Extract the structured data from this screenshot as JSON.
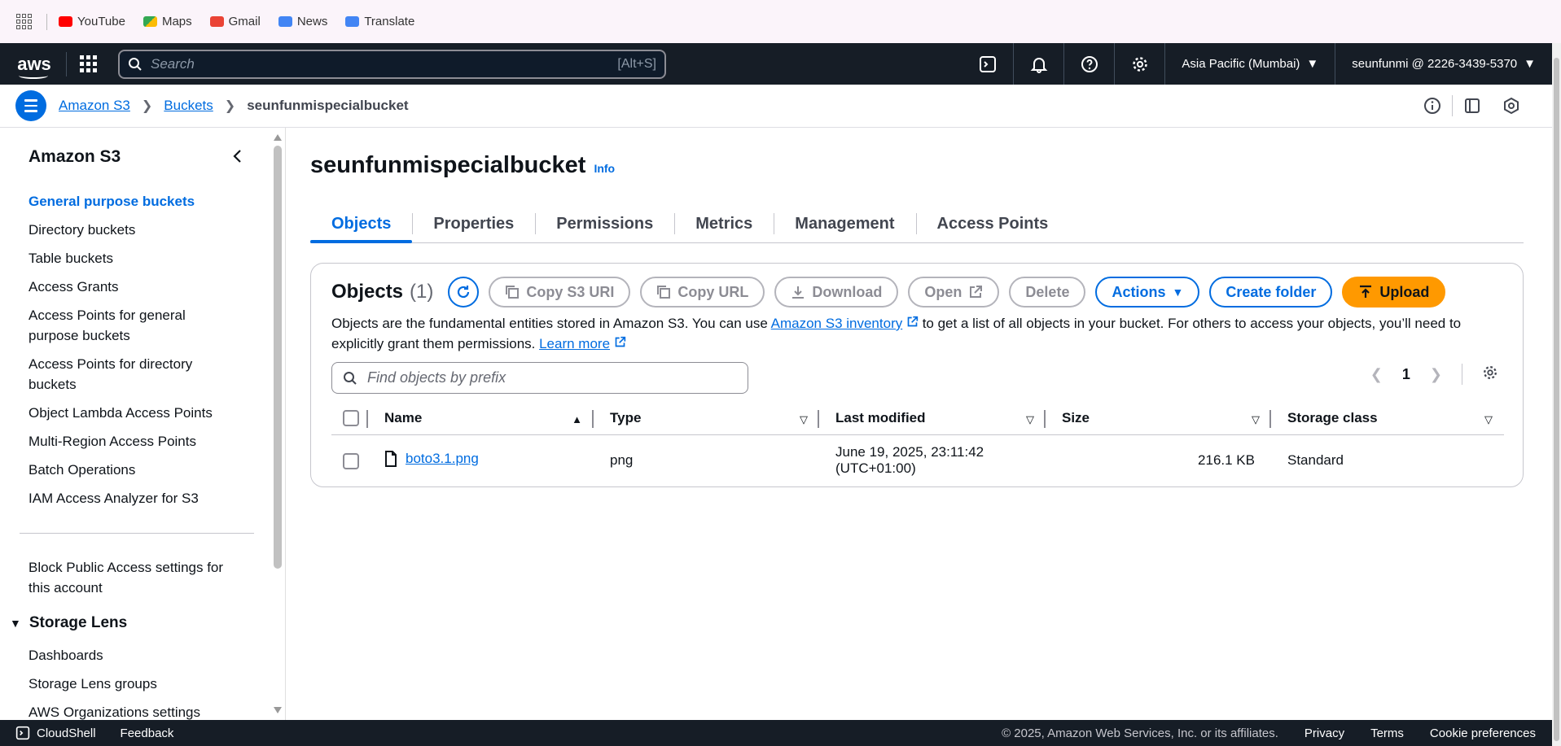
{
  "bookmarks": [
    {
      "label": "YouTube",
      "icon": "youtube-icon",
      "color": "#ff0000"
    },
    {
      "label": "Maps",
      "icon": "maps-icon",
      "color": "#34a853"
    },
    {
      "label": "Gmail",
      "icon": "gmail-icon",
      "color": "#ea4335"
    },
    {
      "label": "News",
      "icon": "news-icon",
      "color": "#4285f4"
    },
    {
      "label": "Translate",
      "icon": "translate-icon",
      "color": "#4285f4"
    }
  ],
  "topnav": {
    "search_placeholder": "Search",
    "search_shortcut": "[Alt+S]",
    "region": "Asia Pacific (Mumbai)",
    "account": "seunfunmi @ 2226-3439-5370"
  },
  "breadcrumb": {
    "items": [
      "Amazon S3",
      "Buckets"
    ],
    "current": "seunfunmispecialbucket"
  },
  "sidebar": {
    "title": "Amazon S3",
    "items": [
      "General purpose buckets",
      "Directory buckets",
      "Table buckets",
      "Access Grants",
      "Access Points for general purpose buckets",
      "Access Points for directory buckets",
      "Object Lambda Access Points",
      "Multi-Region Access Points",
      "Batch Operations",
      "IAM Access Analyzer for S3"
    ],
    "block_public": "Block Public Access settings for this account",
    "section": "Storage Lens",
    "section_items": [
      "Dashboards",
      "Storage Lens groups",
      "AWS Organizations settings"
    ]
  },
  "main": {
    "bucket_name": "seunfunmispecialbucket",
    "info_label": "Info",
    "tabs": [
      "Objects",
      "Properties",
      "Permissions",
      "Metrics",
      "Management",
      "Access Points"
    ],
    "objects": {
      "title": "Objects",
      "count": "(1)",
      "buttons": {
        "copy_uri": "Copy S3 URI",
        "copy_url": "Copy URL",
        "download": "Download",
        "open": "Open",
        "delete": "Delete",
        "actions": "Actions",
        "create_folder": "Create folder",
        "upload": "Upload"
      },
      "desc_1": "Objects are the fundamental entities stored in Amazon S3. You can use ",
      "desc_link": "Amazon S3 inventory",
      "desc_2": " to get a list of all objects in your bucket. For others to access your objects, you’ll need to explicitly grant them permissions. ",
      "desc_learn": "Learn more",
      "find_placeholder": "Find objects by prefix",
      "page": "1",
      "columns": [
        "Name",
        "Type",
        "Last modified",
        "Size",
        "Storage class"
      ],
      "rows": [
        {
          "name": "boto3.1.png",
          "type": "png",
          "modified_1": "June 19, 2025, 23:11:42",
          "modified_2": "(UTC+01:00)",
          "size": "216.1 KB",
          "class": "Standard"
        }
      ]
    }
  },
  "footer": {
    "cloudshell": "CloudShell",
    "feedback": "Feedback",
    "copyright": "© 2025, Amazon Web Services, Inc. or its affiliates.",
    "privacy": "Privacy",
    "terms": "Terms",
    "cookies": "Cookie preferences"
  },
  "colors": {
    "accent": "#006ce0",
    "upload": "#ff9900",
    "nav_bg": "#161d26"
  }
}
